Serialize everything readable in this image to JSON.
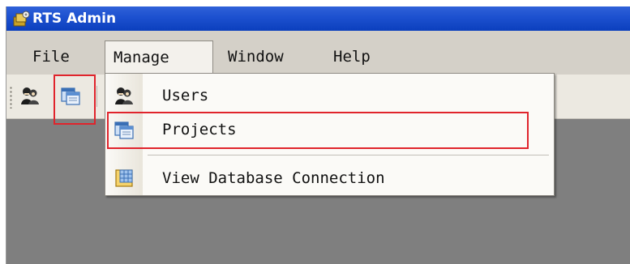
{
  "window": {
    "title": "RTS Admin"
  },
  "menubar": {
    "items": [
      {
        "label": "File"
      },
      {
        "label": "Manage",
        "open": true
      },
      {
        "label": "Window"
      },
      {
        "label": "Help"
      }
    ]
  },
  "toolbar": {
    "buttons": [
      {
        "icon": "users-icon"
      },
      {
        "icon": "projects-icon",
        "highlighted": true
      }
    ]
  },
  "manage_menu": {
    "items": [
      {
        "label": "Users",
        "icon": "users-icon"
      },
      {
        "label": "Projects",
        "icon": "projects-icon",
        "highlighted": true
      },
      {
        "label": "View Database Connection",
        "icon": "database-connection-icon"
      }
    ]
  },
  "colors": {
    "titlebar": "#1c50cf",
    "highlight": "#e0242c",
    "workspace": "#7f7f7f",
    "menubar": "#d4d0c8"
  }
}
